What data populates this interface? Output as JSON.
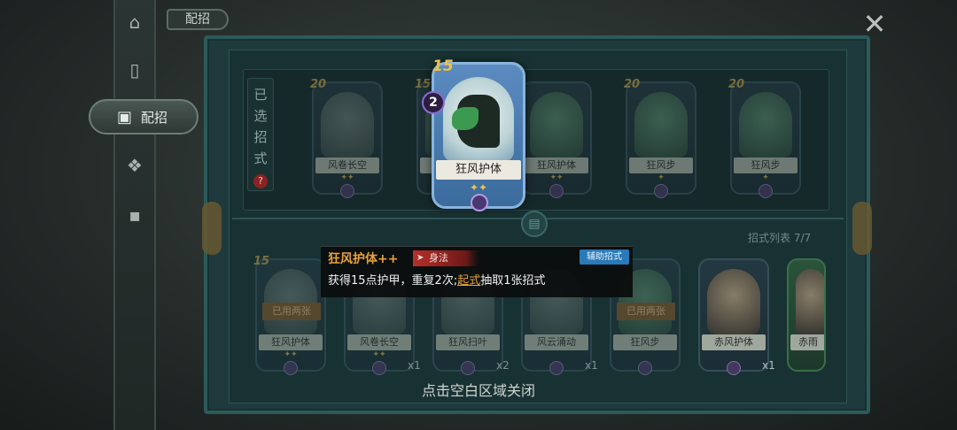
{
  "header": {
    "title": "配招"
  },
  "sidebar": {
    "active_label": "配招"
  },
  "selected": {
    "label": "已选招式",
    "help": "?"
  },
  "top_cards": [
    {
      "cost": "20",
      "name": "风卷长空",
      "stars": "✦✦"
    },
    {
      "cost": "15",
      "name": "狂风护体",
      "stars": "✦✦"
    },
    {
      "cost": "",
      "name": "狂风护体",
      "stars": "✦✦"
    },
    {
      "cost": "20",
      "name": "狂风步",
      "stars": "✦"
    },
    {
      "cost": "20",
      "name": "狂风步",
      "stars": "✦"
    }
  ],
  "lifted_card": {
    "cost": "15",
    "tier": "2",
    "name": "狂风护体",
    "stars": "✦✦"
  },
  "list": {
    "count_label": "招式列表 7/7"
  },
  "bottom_cards": [
    {
      "cost": "15",
      "name": "狂风护体",
      "stars": "✦✦",
      "used": "已用两张",
      "count": ""
    },
    {
      "cost": "",
      "name": "风卷长空",
      "stars": "✦✦",
      "used": "",
      "count": "x1"
    },
    {
      "cost": "",
      "name": "狂风扫叶",
      "stars": "",
      "used": "",
      "count": "x2"
    },
    {
      "cost": "",
      "name": "风云涌动",
      "stars": "",
      "used": "",
      "count": "x1"
    },
    {
      "cost": "",
      "name": "狂风步",
      "stars": "",
      "used": "已用两张",
      "count": ""
    },
    {
      "cost": "",
      "name": "赤风护体",
      "stars": "",
      "used": "",
      "count": "x1"
    },
    {
      "cost": "",
      "name": "赤雨",
      "stars": "",
      "used": "",
      "count": ""
    }
  ],
  "tooltip": {
    "title": "狂风护体++",
    "type": "身法",
    "tag": "辅助招式",
    "desc_before": "获得15点护甲，重复2次;",
    "desc_keyword": "起式",
    "desc_after": "抽取1张招式"
  },
  "hint": "点击空白区域关闭",
  "icons": {
    "close": "close-icon",
    "home": "pagoda-icon",
    "cards": "cards-icon",
    "deck": "deck-icon",
    "emblem": "emblem-icon",
    "card-back": "card-back-icon"
  },
  "colors": {
    "accent_gold": "#f0c246",
    "keyword_orange": "#e8a13c",
    "tag_blue": "#2a7ab8",
    "type_red": "#b72f2a"
  }
}
